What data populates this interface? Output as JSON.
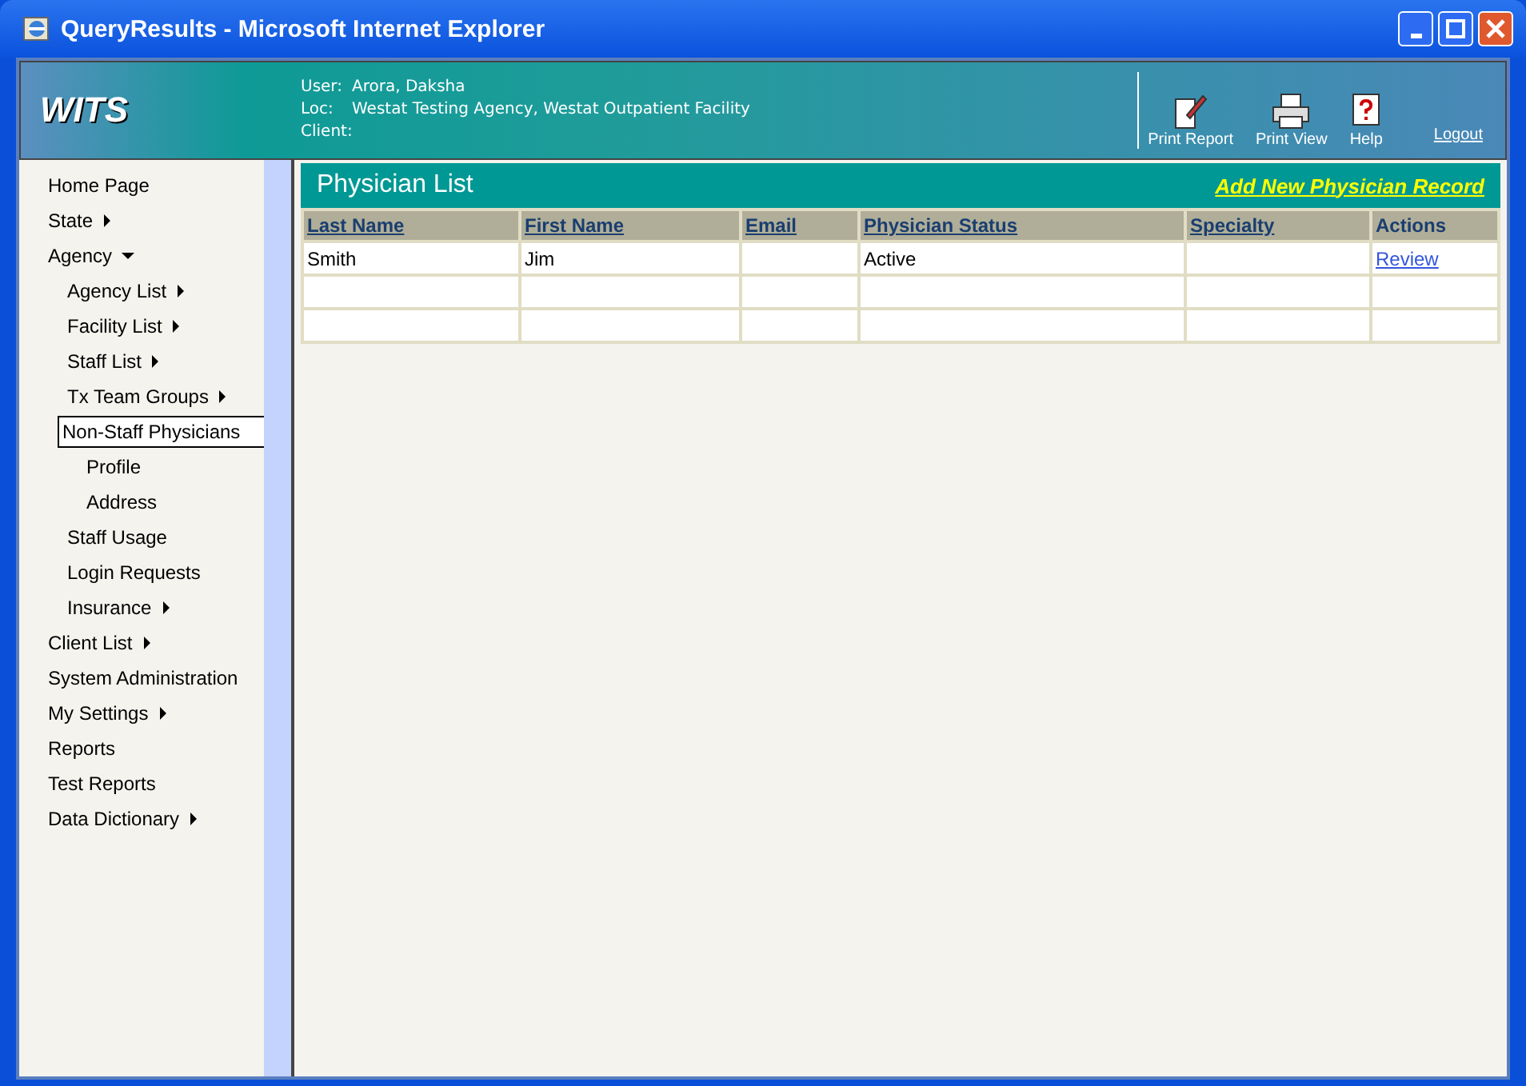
{
  "window": {
    "title": "QueryResults - Microsoft Internet Explorer"
  },
  "header": {
    "logo": "WITS",
    "user_label": "User:",
    "user": "Arora, Daksha",
    "loc_label": "Loc:",
    "loc": "Westat Testing Agency, Westat Outpatient Facility",
    "client_label": "Client:",
    "tools": [
      {
        "kind": "print-report",
        "label": "Print Report"
      },
      {
        "kind": "print-view",
        "label": "Print View"
      },
      {
        "kind": "help",
        "label": "Help"
      }
    ],
    "logout": "Logout"
  },
  "sidebar": {
    "items": [
      {
        "label": "Home Page",
        "selected": false
      },
      {
        "label": "State",
        "kind": "submenu",
        "selected": false
      },
      {
        "label": "Agency",
        "kind": "open-menu",
        "selected": false,
        "children": [
          {
            "label": "Agency List",
            "kind": "submenu",
            "selected": false
          },
          {
            "label": "Facility List",
            "kind": "submenu",
            "selected": false
          },
          {
            "label": "Staff List",
            "kind": "submenu",
            "selected": false
          },
          {
            "label": "Tx Team Groups",
            "kind": "submenu",
            "selected": false
          },
          {
            "label": "Non-Staff Physicians",
            "selected": true,
            "children": [
              {
                "label": "Profile",
                "selected": false
              },
              {
                "label": "Address",
                "selected": false
              }
            ]
          },
          {
            "label": "Staff Usage",
            "selected": false
          },
          {
            "label": "Login Requests",
            "selected": false
          },
          {
            "label": "Insurance",
            "kind": "submenu",
            "selected": false
          }
        ]
      },
      {
        "label": "Client List",
        "kind": "submenu",
        "selected": false
      },
      {
        "label": "System Administration",
        "selected": false
      },
      {
        "label": "My Settings",
        "kind": "submenu",
        "selected": false
      },
      {
        "label": "Reports",
        "selected": false
      },
      {
        "label": "Test Reports",
        "selected": false
      },
      {
        "label": "Data Dictionary",
        "kind": "submenu",
        "selected": false
      }
    ]
  },
  "panel": {
    "title": "Physician List",
    "add_link": "Add New Physician Record"
  },
  "table": {
    "columns": [
      {
        "label": "Last Name",
        "sortable": true
      },
      {
        "label": "First Name",
        "sortable": true
      },
      {
        "label": "Email",
        "sortable": true
      },
      {
        "label": "Physician Status",
        "sortable": true
      },
      {
        "label": "Specialty",
        "sortable": true
      },
      {
        "label": "Actions",
        "sortable": false
      }
    ],
    "rows": [
      {
        "cells": [
          "Smith",
          "Jim",
          "",
          "Active",
          ""
        ],
        "action": "Review"
      }
    ]
  }
}
